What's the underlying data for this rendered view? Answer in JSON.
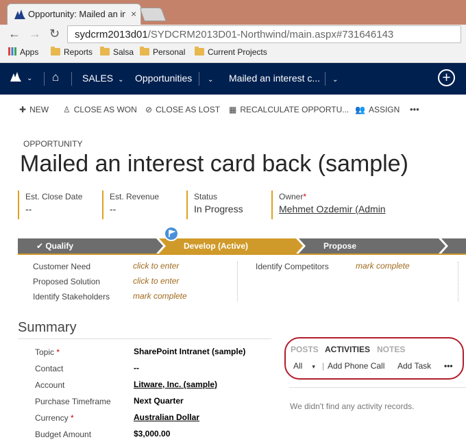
{
  "browser": {
    "tab_title": "Opportunity: Mailed an interest card back",
    "url_host": "sydcrm2013d01",
    "url_path": "/SYDCRM2013D01-Northwind/main.aspx#731646143",
    "bookmarks": [
      "Apps",
      "Reports",
      "Salsa",
      "Personal",
      "Current Projects"
    ]
  },
  "nav": {
    "area": "SALES",
    "entity": "Opportunities",
    "record": "Mailed an interest c..."
  },
  "commands": {
    "new": "NEW",
    "close_won": "CLOSE AS WON",
    "close_lost": "CLOSE AS LOST",
    "recalculate": "RECALCULATE OPPORTU...",
    "assign": "ASSIGN",
    "more": "•••"
  },
  "header": {
    "entity_type": "OPPORTUNITY",
    "title": "Mailed an interest card back (sample)",
    "fields": [
      {
        "label": "Est. Close Date",
        "value": "--",
        "required": ""
      },
      {
        "label": "Est. Revenue",
        "value": "--",
        "required": ""
      },
      {
        "label": "Status",
        "value": "In Progress",
        "required": ""
      },
      {
        "label": "Owner",
        "value": "Mehmet Ozdemir (Admin",
        "required": "*"
      }
    ]
  },
  "process": {
    "stages": [
      "Qualify",
      "Develop (Active)",
      "Propose"
    ],
    "steps_left": [
      {
        "label": "Customer Need",
        "value": "click to enter"
      },
      {
        "label": "Proposed Solution",
        "value": "click to enter"
      },
      {
        "label": "Identify Stakeholders",
        "value": "mark complete"
      }
    ],
    "steps_right": [
      {
        "label": "Identify Competitors",
        "value": "mark complete"
      }
    ]
  },
  "summary": {
    "title": "Summary",
    "fields": [
      {
        "label": "Topic",
        "value": "SharePoint Intranet (sample)",
        "required": "*"
      },
      {
        "label": "Contact",
        "value": "--",
        "required": ""
      },
      {
        "label": "Account",
        "value": "Litware, Inc. (sample)",
        "required": ""
      },
      {
        "label": "Purchase Timeframe",
        "value": "Next Quarter",
        "required": ""
      },
      {
        "label": "Currency",
        "value": "Australian Dollar",
        "required": "*"
      },
      {
        "label": "Budget Amount",
        "value": "$3,000.00",
        "required": ""
      }
    ]
  },
  "social": {
    "tabs": [
      "POSTS",
      "ACTIVITIES",
      "NOTES"
    ],
    "filter": "All",
    "actions": [
      "Add Phone Call",
      "Add Task"
    ],
    "more": "•••",
    "empty_message": "We didn't find any activity records."
  },
  "colors": {
    "nav_bg": "#002050",
    "stage_active": "#d09a2a",
    "stage_inactive": "#6d6d6d",
    "highlight_oval": "#b11d2c",
    "required": "#cc0000"
  }
}
